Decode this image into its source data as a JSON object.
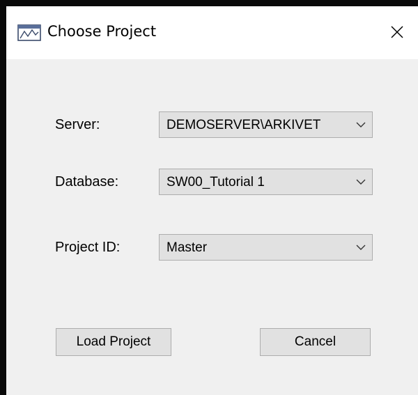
{
  "window": {
    "title": "Choose Project",
    "close_symbol": "×"
  },
  "form": {
    "server": {
      "label": "Server:",
      "value": "DEMOSERVER\\ARKIVET"
    },
    "database": {
      "label": "Database:",
      "value": "SW00_Tutorial 1"
    },
    "project_id": {
      "label": "Project ID:",
      "value": "Master"
    }
  },
  "buttons": {
    "load_label": "Load Project",
    "cancel_label": "Cancel"
  },
  "icons": {
    "app": "app-window-icon",
    "close": "close-icon",
    "dropdown": "chevron-down-icon"
  },
  "colors": {
    "frame": "#0a0a0a",
    "titlebar": "#ffffff",
    "dialog_bg": "#f0f0f0",
    "control_bg": "#e1e1e1",
    "control_border": "#adadad"
  }
}
